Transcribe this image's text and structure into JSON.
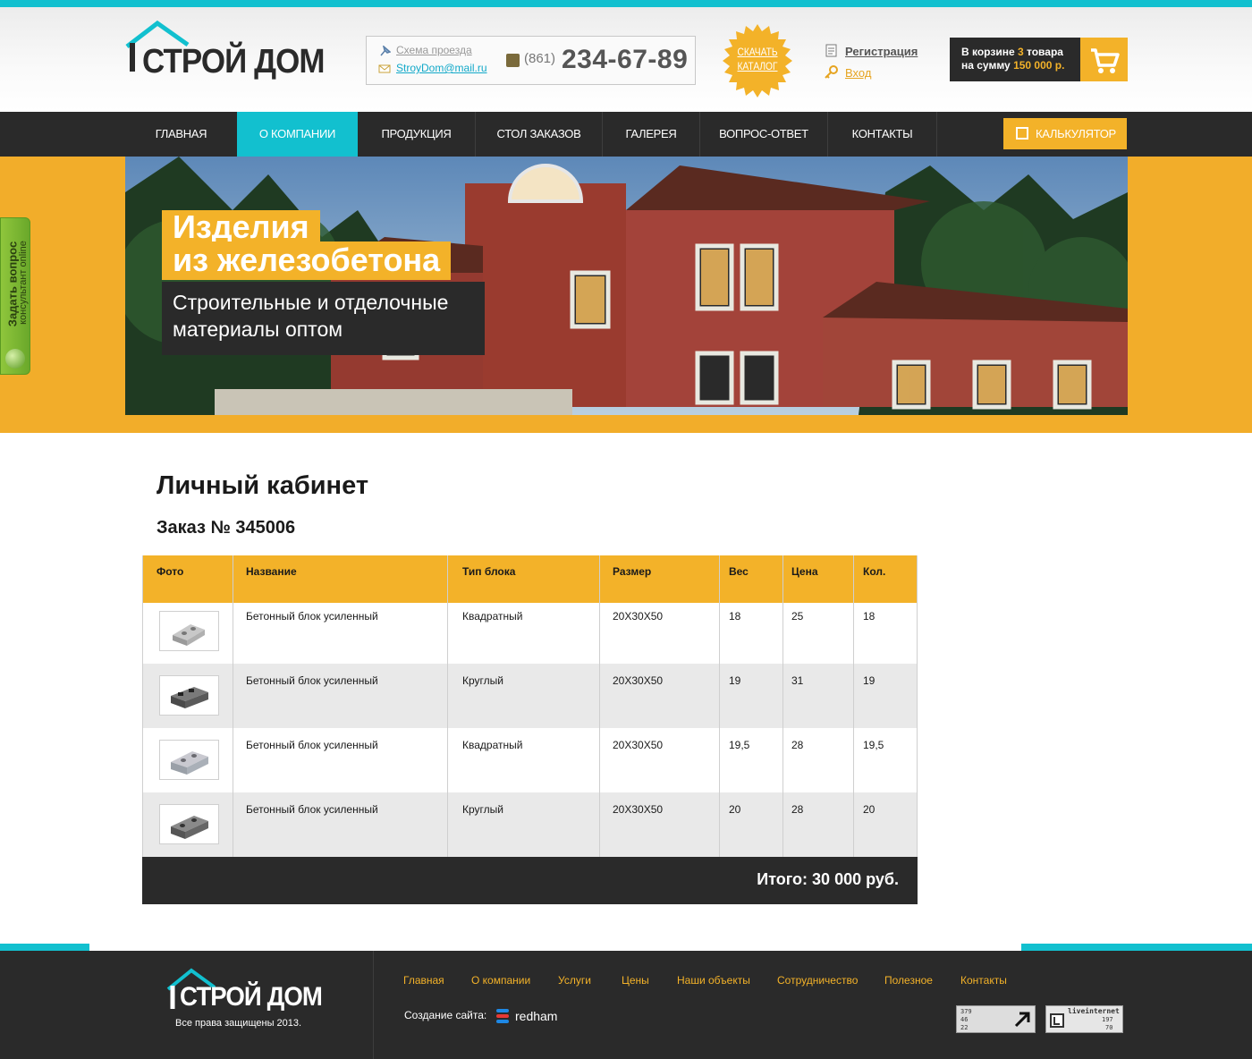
{
  "header": {
    "logo_text": "СТРОЙ ДОМ",
    "route_link": "Схема проезда",
    "email_link": "StroyDom@mail.ru",
    "phone_code": "(861)",
    "phone_number": "234-67-89",
    "catalog_badge": "СКАЧАТЬ КАТАЛОГ",
    "register_link": "Регистрация",
    "login_link": "Вход",
    "cart": {
      "line1_prefix": "В корзине",
      "count": "3",
      "line1_suffix": "товара",
      "line2_prefix": "на сумму",
      "sum": "150 000 р."
    }
  },
  "nav": {
    "items": [
      {
        "label": "ГЛАВНАЯ"
      },
      {
        "label": "О КОМПАНИИ"
      },
      {
        "label": "ПРОДУКЦИЯ"
      },
      {
        "label": "СТОЛ ЗАКАЗОВ"
      },
      {
        "label": "ГАЛЕРЕЯ"
      },
      {
        "label": "ВОПРОС-ОТВЕТ"
      },
      {
        "label": "КОНТАКТЫ"
      }
    ],
    "active_index": 1,
    "calculator": "КАЛЬКУЛЯТОР"
  },
  "banner": {
    "title_line1": "Изделия",
    "title_line2": "из железобетона",
    "subtitle_line1": "Строительные и отделочные",
    "subtitle_line2": "материалы оптом"
  },
  "side_tab": {
    "title": "Задать вопрос",
    "subtitle": "консультант online"
  },
  "content": {
    "page_title": "Личный кабинет",
    "order_title": "Заказ № 345006",
    "table": {
      "headers": [
        "Фото",
        "Название",
        "Тип блока",
        "Размер",
        "Вес",
        "Цена",
        "Кол."
      ],
      "rows": [
        {
          "name": "Бетонный блок усиленный",
          "type": "Квадратный",
          "size": "20Х30Х50",
          "weight": "18",
          "price": "25",
          "qty": "18"
        },
        {
          "name": "Бетонный блок усиленный",
          "type": "Круглый",
          "size": "20Х30Х50",
          "weight": "19",
          "price": "31",
          "qty": "19"
        },
        {
          "name": "Бетонный блок усиленный",
          "type": "Квадратный",
          "size": "20Х30Х50",
          "weight": "19,5",
          "price": "28",
          "qty": "19,5"
        },
        {
          "name": "Бетонный блок усиленный",
          "type": "Круглый",
          "size": "20Х30Х50",
          "weight": "20",
          "price": "28",
          "qty": "20"
        }
      ],
      "total": "Итого: 30 000 руб."
    }
  },
  "footer": {
    "logo_text": "СТРОЙ ДОМ",
    "copyright": "Все права защищены 2013.",
    "links": [
      "Главная",
      "О компании",
      "Услуги",
      "Цены",
      "Наши объекты",
      "Сотрудничество",
      "Полезное",
      "Контакты"
    ],
    "made_by_label": "Создание сайта:",
    "made_by": "redham",
    "counter1": [
      "379",
      "46",
      "22"
    ],
    "counter2_label": "liveinternet",
    "counter2": [
      "197",
      "70"
    ]
  },
  "colors": {
    "accent_cyan": "#12c0cf",
    "accent_yellow": "#f3b229",
    "dark": "#2a2a2a"
  }
}
